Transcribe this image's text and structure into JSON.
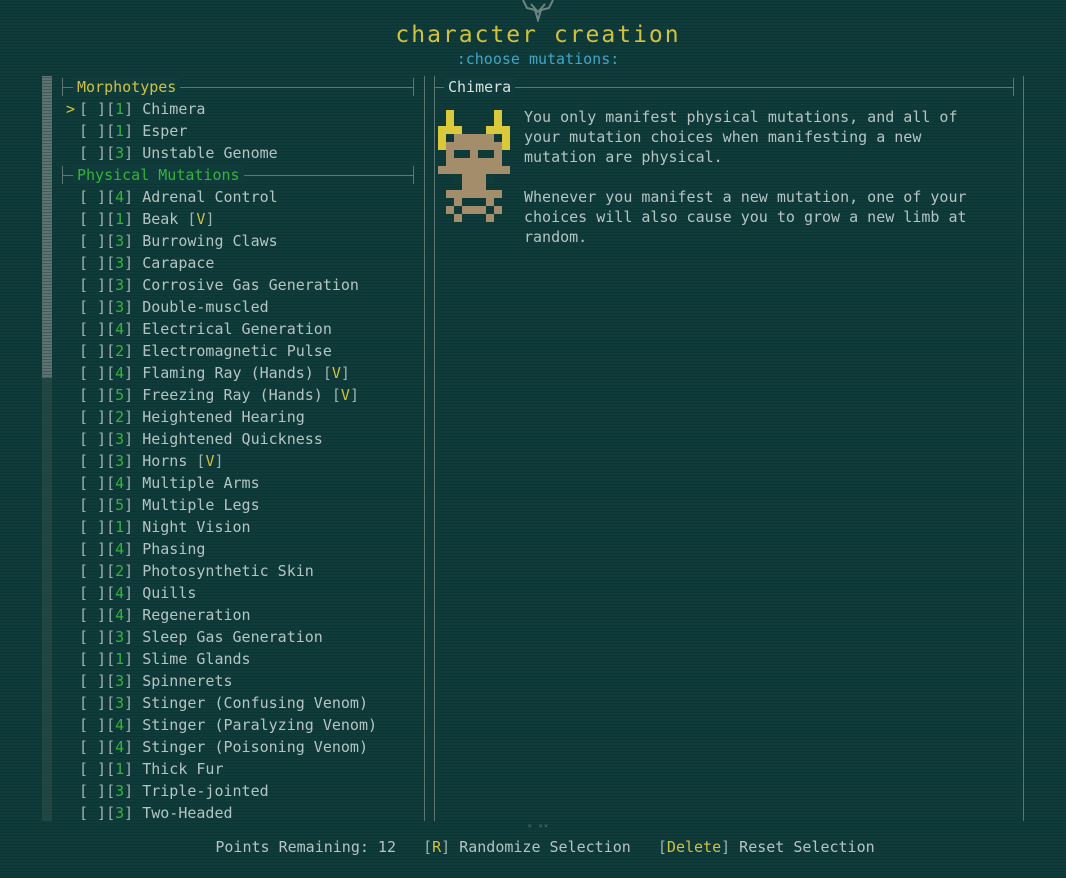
{
  "header": {
    "title": "character creation",
    "subtitle": ":choose mutations:"
  },
  "morphotypes": {
    "heading": "Morphotypes",
    "items": [
      {
        "cost": "1",
        "name": "Chimera",
        "selected_cursor": true
      },
      {
        "cost": "1",
        "name": "Esper"
      },
      {
        "cost": "3",
        "name": "Unstable Genome"
      }
    ]
  },
  "physical": {
    "heading": "Physical Mutations",
    "items": [
      {
        "cost": "4",
        "name": "Adrenal Control",
        "tag": ""
      },
      {
        "cost": "1",
        "name": "Beak ",
        "tag": "V"
      },
      {
        "cost": "3",
        "name": "Burrowing Claws",
        "tag": ""
      },
      {
        "cost": "3",
        "name": "Carapace",
        "tag": ""
      },
      {
        "cost": "3",
        "name": "Corrosive Gas Generation",
        "tag": ""
      },
      {
        "cost": "3",
        "name": "Double-muscled",
        "tag": ""
      },
      {
        "cost": "4",
        "name": "Electrical Generation",
        "tag": ""
      },
      {
        "cost": "2",
        "name": "Electromagnetic Pulse",
        "tag": ""
      },
      {
        "cost": "4",
        "name": "Flaming Ray (Hands) ",
        "tag": "V"
      },
      {
        "cost": "5",
        "name": "Freezing Ray (Hands) ",
        "tag": "V"
      },
      {
        "cost": "2",
        "name": "Heightened Hearing",
        "tag": ""
      },
      {
        "cost": "3",
        "name": "Heightened Quickness",
        "tag": ""
      },
      {
        "cost": "3",
        "name": "Horns ",
        "tag": "V"
      },
      {
        "cost": "4",
        "name": "Multiple Arms",
        "tag": ""
      },
      {
        "cost": "5",
        "name": "Multiple Legs",
        "tag": ""
      },
      {
        "cost": "1",
        "name": "Night Vision",
        "tag": ""
      },
      {
        "cost": "4",
        "name": "Phasing",
        "tag": ""
      },
      {
        "cost": "2",
        "name": "Photosynthetic Skin",
        "tag": ""
      },
      {
        "cost": "4",
        "name": "Quills",
        "tag": ""
      },
      {
        "cost": "4",
        "name": "Regeneration",
        "tag": ""
      },
      {
        "cost": "3",
        "name": "Sleep Gas Generation",
        "tag": ""
      },
      {
        "cost": "1",
        "name": "Slime Glands",
        "tag": ""
      },
      {
        "cost": "3",
        "name": "Spinnerets",
        "tag": ""
      },
      {
        "cost": "3",
        "name": "Stinger (Confusing Venom)",
        "tag": ""
      },
      {
        "cost": "4",
        "name": "Stinger (Paralyzing Venom)",
        "tag": ""
      },
      {
        "cost": "4",
        "name": "Stinger (Poisoning Venom)",
        "tag": ""
      },
      {
        "cost": "1",
        "name": "Thick Fur",
        "tag": ""
      },
      {
        "cost": "3",
        "name": "Triple-jointed",
        "tag": ""
      },
      {
        "cost": "3",
        "name": "Two-Headed",
        "tag": ""
      }
    ]
  },
  "detail": {
    "title": "Chimera",
    "icon": "chimera-skull-icon",
    "description": "You only manifest physical mutations, and all of\nyour mutation choices when manifesting a new\nmutation are physical.\n\nWhenever you manifest a new mutation, one of your\nchoices will also cause you to grow a new limb at\nrandom."
  },
  "footer": {
    "points_label": "Points Remaining:",
    "points_value": "12",
    "randomize_key": "R",
    "randomize_label": "Randomize Selection",
    "reset_key": "Delete",
    "reset_label": "Reset Selection"
  },
  "colors": {
    "background": "#0f3b3a",
    "accent_yellow": "#cfc23f",
    "accent_green": "#36b33b",
    "accent_cyan": "#3fa6c6"
  }
}
